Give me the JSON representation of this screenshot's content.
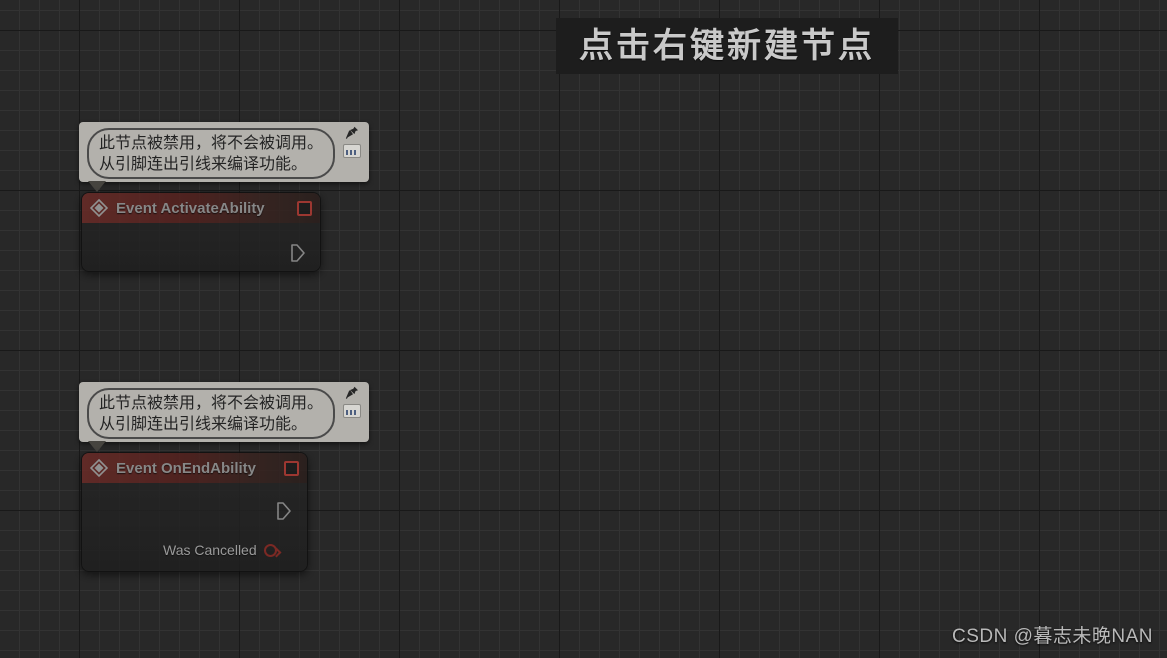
{
  "banner": {
    "text": "点击右键新建节点"
  },
  "watermark": {
    "text": "CSDN @暮志未晚NAN"
  },
  "comments": [
    {
      "line1": "此节点被禁用，将不会被调用。",
      "line2": "从引脚连出引线来编译功能。",
      "pin_icon": "pushpin-icon",
      "note_icon": "comment-note-icon"
    },
    {
      "line1": "此节点被禁用，将不会被调用。",
      "line2": "从引脚连出引线来编译功能。",
      "pin_icon": "pushpin-icon",
      "note_icon": "comment-note-icon"
    }
  ],
  "nodes": [
    {
      "title": "Event ActivateAbility",
      "icon": "event-diamond-icon",
      "delegate_pin": "delegate-output-pin",
      "exec_pin": "exec-output-pin",
      "pins": []
    },
    {
      "title": "Event OnEndAbility",
      "icon": "event-diamond-icon",
      "delegate_pin": "delegate-output-pin",
      "exec_pin": "exec-output-pin",
      "pins": [
        {
          "label": "Was Cancelled",
          "type": "boolean"
        }
      ]
    }
  ],
  "colors": {
    "canvas_bg": "#282828",
    "grid_minor": "#333333",
    "grid_major": "#191919",
    "node_header_red": "#6d2b27",
    "node_body": "#222222",
    "pin_red": "#b63b33",
    "bool_pin_red": "#8e2a24",
    "comment_bg": "#b3b1ac",
    "comment_text": "#242424",
    "banner_bg": "#1d1d1d",
    "banner_text": "#c9c9c9",
    "title_text": "#9d9d9d",
    "watermark_text": "#b9b9b9"
  }
}
